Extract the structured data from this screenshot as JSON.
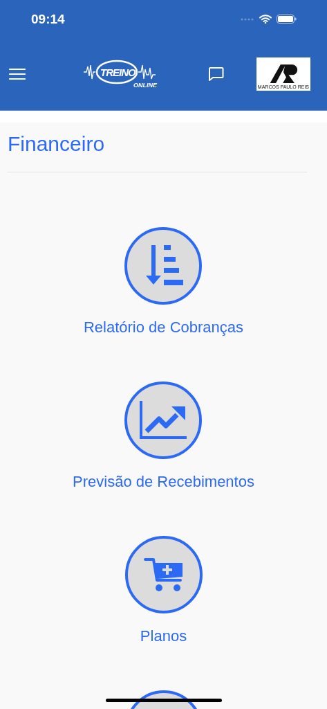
{
  "status_bar": {
    "time": "09:14"
  },
  "header": {
    "logo": {
      "word": "TREINO",
      "subword": "ONLINE"
    },
    "profile_badge": {
      "caption": "MARCOS PAULO REIS"
    }
  },
  "page": {
    "title": "Financeiro"
  },
  "items": [
    {
      "kind": "report",
      "label": "Relatório de Cobranças"
    },
    {
      "kind": "chart",
      "label": "Previsão de Recebimentos"
    },
    {
      "kind": "cart",
      "label": "Planos"
    },
    {
      "kind": "partial"
    }
  ]
}
